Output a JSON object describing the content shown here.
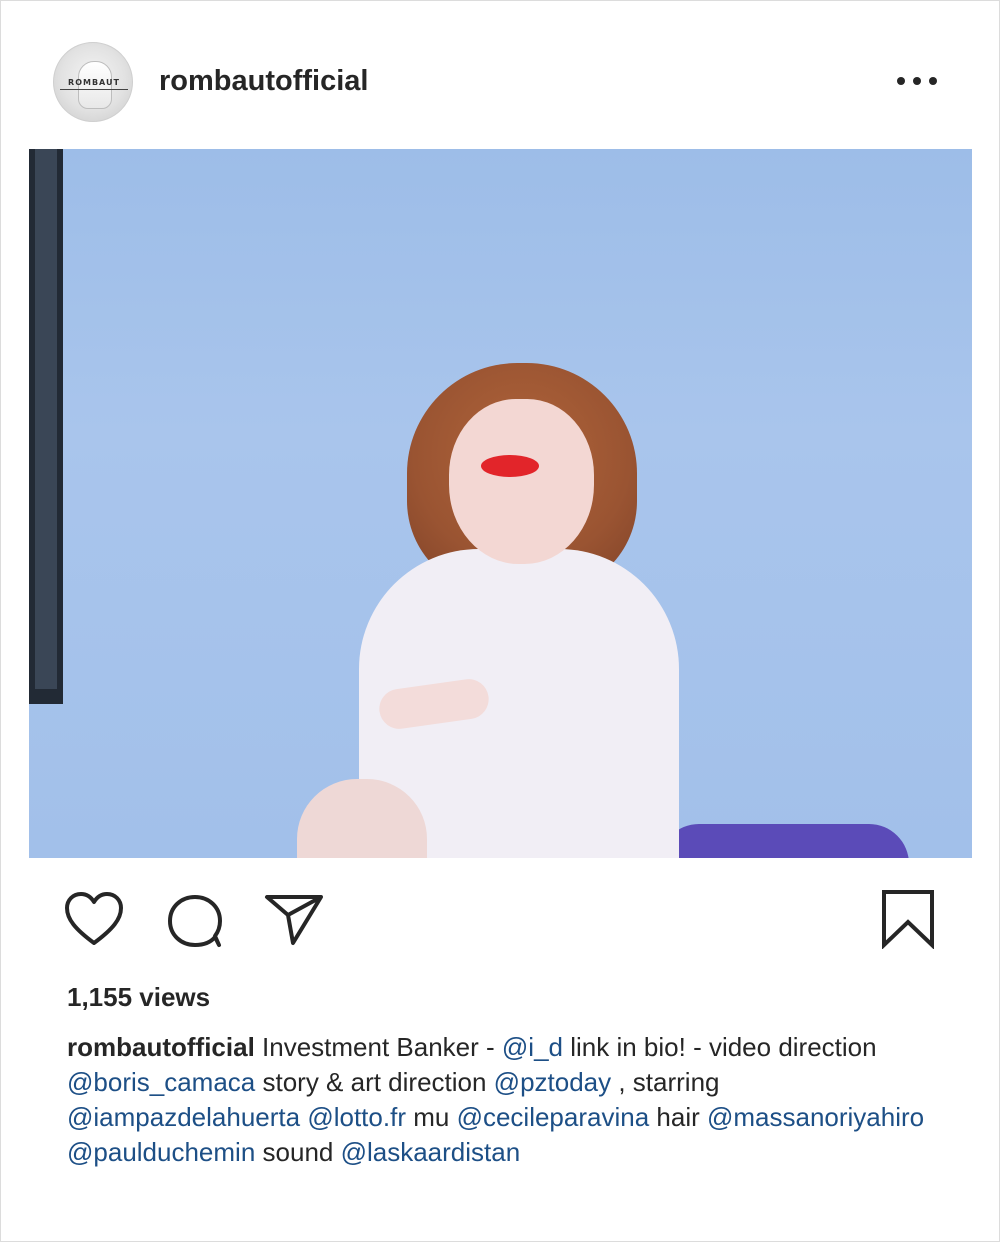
{
  "post": {
    "username": "rombautofficial",
    "avatar_logo": "ROMBAUT",
    "more_icon": "more-horizontal-icon"
  },
  "actions": {
    "like_icon": "heart-icon",
    "comment_icon": "comment-icon",
    "share_icon": "paper-plane-icon",
    "save_icon": "bookmark-icon"
  },
  "stats": {
    "views": "1,155 views"
  },
  "caption": {
    "username": "rombautofficial",
    "segments": [
      {
        "text": " Investment Banker - ",
        "type": "text"
      },
      {
        "text": "@i_d",
        "type": "mention"
      },
      {
        "text": " link in bio! - video direction ",
        "type": "text"
      },
      {
        "text": "@boris_camaca",
        "type": "mention"
      },
      {
        "text": " story & art direction ",
        "type": "text"
      },
      {
        "text": "@pztoday",
        "type": "mention"
      },
      {
        "text": " , starring ",
        "type": "text"
      },
      {
        "text": "@iampazdelahuerta",
        "type": "mention"
      },
      {
        "text": " ",
        "type": "text"
      },
      {
        "text": "@lotto.fr",
        "type": "mention"
      },
      {
        "text": " mu ",
        "type": "text"
      },
      {
        "text": "@cecileparavina",
        "type": "mention"
      },
      {
        "text": " hair ",
        "type": "text"
      },
      {
        "text": "@massanoriyahiro",
        "type": "mention"
      },
      {
        "text": " ",
        "type": "text"
      },
      {
        "text": "@paulduchemin",
        "type": "mention"
      },
      {
        "text": " sound ",
        "type": "text"
      },
      {
        "text": "@laskaardistan",
        "type": "mention"
      }
    ]
  },
  "colors": {
    "mention": "#1d4f86",
    "text": "#262626",
    "background": "#ffffff"
  }
}
